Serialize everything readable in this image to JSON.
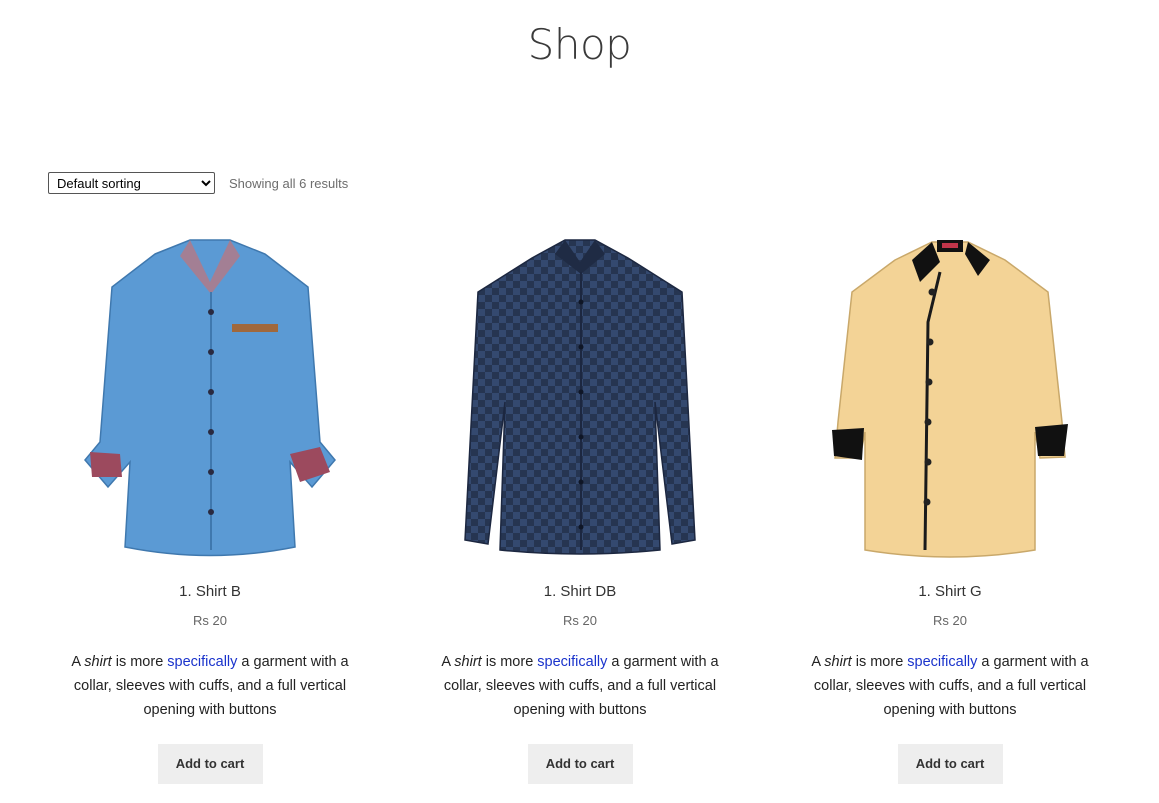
{
  "page": {
    "title": "Shop"
  },
  "toolbar": {
    "sort_selected": "Default sorting",
    "result_count": "Showing all 6 results"
  },
  "products": [
    {
      "name": "1. Shirt B",
      "currency": "Rs",
      "price": "20",
      "desc_pre": "A ",
      "desc_em": "shirt",
      "desc_mid": " is more ",
      "desc_link": "specifically",
      "desc_post": " a garment with a collar, sleeves with cuffs, and a full vertical opening with buttons",
      "button": "Add to cart",
      "color": "#5b9ad4"
    },
    {
      "name": "1. Shirt DB",
      "currency": "Rs",
      "price": "20",
      "desc_pre": "A ",
      "desc_em": "shirt",
      "desc_mid": " is more ",
      "desc_link": "specifically",
      "desc_post": " a garment with a collar, sleeves with cuffs, and a full vertical opening with buttons",
      "button": "Add to cart",
      "color": "#2e3f5e"
    },
    {
      "name": "1. Shirt G",
      "currency": "Rs",
      "price": "20",
      "desc_pre": "A ",
      "desc_em": "shirt",
      "desc_mid": " is more ",
      "desc_link": "specifically",
      "desc_post": " a garment with a collar, sleeves with cuffs, and a full vertical opening with buttons",
      "button": "Add to cart",
      "color": "#f3d396"
    }
  ]
}
